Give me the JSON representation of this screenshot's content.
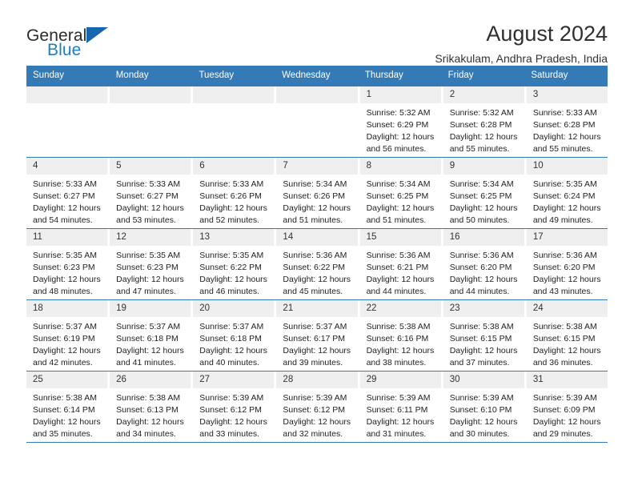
{
  "brand": {
    "name_part1": "General",
    "name_part2": "Blue",
    "triangle_color": "#1667ae",
    "blue_color": "#1b7fc4"
  },
  "header": {
    "title": "August 2024",
    "location": "Srikakulam, Andhra Pradesh, India"
  },
  "theme": {
    "header_bg": "#337ab7",
    "header_text": "#ffffff",
    "daynum_bg": "#efefef",
    "row_divider": "#337ab7"
  },
  "weekdays": [
    "Sunday",
    "Monday",
    "Tuesday",
    "Wednesday",
    "Thursday",
    "Friday",
    "Saturday"
  ],
  "labels": {
    "sunrise_prefix": "Sunrise: ",
    "sunset_prefix": "Sunset: ",
    "daylight_prefix": "Daylight: "
  },
  "weeks": [
    [
      {
        "day": "",
        "sunrise": "",
        "sunset": "",
        "daylight_line1": "",
        "daylight_line2": ""
      },
      {
        "day": "",
        "sunrise": "",
        "sunset": "",
        "daylight_line1": "",
        "daylight_line2": ""
      },
      {
        "day": "",
        "sunrise": "",
        "sunset": "",
        "daylight_line1": "",
        "daylight_line2": ""
      },
      {
        "day": "",
        "sunrise": "",
        "sunset": "",
        "daylight_line1": "",
        "daylight_line2": ""
      },
      {
        "day": "1",
        "sunrise": "Sunrise: 5:32 AM",
        "sunset": "Sunset: 6:29 PM",
        "daylight_line1": "Daylight: 12 hours",
        "daylight_line2": "and 56 minutes."
      },
      {
        "day": "2",
        "sunrise": "Sunrise: 5:32 AM",
        "sunset": "Sunset: 6:28 PM",
        "daylight_line1": "Daylight: 12 hours",
        "daylight_line2": "and 55 minutes."
      },
      {
        "day": "3",
        "sunrise": "Sunrise: 5:33 AM",
        "sunset": "Sunset: 6:28 PM",
        "daylight_line1": "Daylight: 12 hours",
        "daylight_line2": "and 55 minutes."
      }
    ],
    [
      {
        "day": "4",
        "sunrise": "Sunrise: 5:33 AM",
        "sunset": "Sunset: 6:27 PM",
        "daylight_line1": "Daylight: 12 hours",
        "daylight_line2": "and 54 minutes."
      },
      {
        "day": "5",
        "sunrise": "Sunrise: 5:33 AM",
        "sunset": "Sunset: 6:27 PM",
        "daylight_line1": "Daylight: 12 hours",
        "daylight_line2": "and 53 minutes."
      },
      {
        "day": "6",
        "sunrise": "Sunrise: 5:33 AM",
        "sunset": "Sunset: 6:26 PM",
        "daylight_line1": "Daylight: 12 hours",
        "daylight_line2": "and 52 minutes."
      },
      {
        "day": "7",
        "sunrise": "Sunrise: 5:34 AM",
        "sunset": "Sunset: 6:26 PM",
        "daylight_line1": "Daylight: 12 hours",
        "daylight_line2": "and 51 minutes."
      },
      {
        "day": "8",
        "sunrise": "Sunrise: 5:34 AM",
        "sunset": "Sunset: 6:25 PM",
        "daylight_line1": "Daylight: 12 hours",
        "daylight_line2": "and 51 minutes."
      },
      {
        "day": "9",
        "sunrise": "Sunrise: 5:34 AM",
        "sunset": "Sunset: 6:25 PM",
        "daylight_line1": "Daylight: 12 hours",
        "daylight_line2": "and 50 minutes."
      },
      {
        "day": "10",
        "sunrise": "Sunrise: 5:35 AM",
        "sunset": "Sunset: 6:24 PM",
        "daylight_line1": "Daylight: 12 hours",
        "daylight_line2": "and 49 minutes."
      }
    ],
    [
      {
        "day": "11",
        "sunrise": "Sunrise: 5:35 AM",
        "sunset": "Sunset: 6:23 PM",
        "daylight_line1": "Daylight: 12 hours",
        "daylight_line2": "and 48 minutes."
      },
      {
        "day": "12",
        "sunrise": "Sunrise: 5:35 AM",
        "sunset": "Sunset: 6:23 PM",
        "daylight_line1": "Daylight: 12 hours",
        "daylight_line2": "and 47 minutes."
      },
      {
        "day": "13",
        "sunrise": "Sunrise: 5:35 AM",
        "sunset": "Sunset: 6:22 PM",
        "daylight_line1": "Daylight: 12 hours",
        "daylight_line2": "and 46 minutes."
      },
      {
        "day": "14",
        "sunrise": "Sunrise: 5:36 AM",
        "sunset": "Sunset: 6:22 PM",
        "daylight_line1": "Daylight: 12 hours",
        "daylight_line2": "and 45 minutes."
      },
      {
        "day": "15",
        "sunrise": "Sunrise: 5:36 AM",
        "sunset": "Sunset: 6:21 PM",
        "daylight_line1": "Daylight: 12 hours",
        "daylight_line2": "and 44 minutes."
      },
      {
        "day": "16",
        "sunrise": "Sunrise: 5:36 AM",
        "sunset": "Sunset: 6:20 PM",
        "daylight_line1": "Daylight: 12 hours",
        "daylight_line2": "and 44 minutes."
      },
      {
        "day": "17",
        "sunrise": "Sunrise: 5:36 AM",
        "sunset": "Sunset: 6:20 PM",
        "daylight_line1": "Daylight: 12 hours",
        "daylight_line2": "and 43 minutes."
      }
    ],
    [
      {
        "day": "18",
        "sunrise": "Sunrise: 5:37 AM",
        "sunset": "Sunset: 6:19 PM",
        "daylight_line1": "Daylight: 12 hours",
        "daylight_line2": "and 42 minutes."
      },
      {
        "day": "19",
        "sunrise": "Sunrise: 5:37 AM",
        "sunset": "Sunset: 6:18 PM",
        "daylight_line1": "Daylight: 12 hours",
        "daylight_line2": "and 41 minutes."
      },
      {
        "day": "20",
        "sunrise": "Sunrise: 5:37 AM",
        "sunset": "Sunset: 6:18 PM",
        "daylight_line1": "Daylight: 12 hours",
        "daylight_line2": "and 40 minutes."
      },
      {
        "day": "21",
        "sunrise": "Sunrise: 5:37 AM",
        "sunset": "Sunset: 6:17 PM",
        "daylight_line1": "Daylight: 12 hours",
        "daylight_line2": "and 39 minutes."
      },
      {
        "day": "22",
        "sunrise": "Sunrise: 5:38 AM",
        "sunset": "Sunset: 6:16 PM",
        "daylight_line1": "Daylight: 12 hours",
        "daylight_line2": "and 38 minutes."
      },
      {
        "day": "23",
        "sunrise": "Sunrise: 5:38 AM",
        "sunset": "Sunset: 6:15 PM",
        "daylight_line1": "Daylight: 12 hours",
        "daylight_line2": "and 37 minutes."
      },
      {
        "day": "24",
        "sunrise": "Sunrise: 5:38 AM",
        "sunset": "Sunset: 6:15 PM",
        "daylight_line1": "Daylight: 12 hours",
        "daylight_line2": "and 36 minutes."
      }
    ],
    [
      {
        "day": "25",
        "sunrise": "Sunrise: 5:38 AM",
        "sunset": "Sunset: 6:14 PM",
        "daylight_line1": "Daylight: 12 hours",
        "daylight_line2": "and 35 minutes."
      },
      {
        "day": "26",
        "sunrise": "Sunrise: 5:38 AM",
        "sunset": "Sunset: 6:13 PM",
        "daylight_line1": "Daylight: 12 hours",
        "daylight_line2": "and 34 minutes."
      },
      {
        "day": "27",
        "sunrise": "Sunrise: 5:39 AM",
        "sunset": "Sunset: 6:12 PM",
        "daylight_line1": "Daylight: 12 hours",
        "daylight_line2": "and 33 minutes."
      },
      {
        "day": "28",
        "sunrise": "Sunrise: 5:39 AM",
        "sunset": "Sunset: 6:12 PM",
        "daylight_line1": "Daylight: 12 hours",
        "daylight_line2": "and 32 minutes."
      },
      {
        "day": "29",
        "sunrise": "Sunrise: 5:39 AM",
        "sunset": "Sunset: 6:11 PM",
        "daylight_line1": "Daylight: 12 hours",
        "daylight_line2": "and 31 minutes."
      },
      {
        "day": "30",
        "sunrise": "Sunrise: 5:39 AM",
        "sunset": "Sunset: 6:10 PM",
        "daylight_line1": "Daylight: 12 hours",
        "daylight_line2": "and 30 minutes."
      },
      {
        "day": "31",
        "sunrise": "Sunrise: 5:39 AM",
        "sunset": "Sunset: 6:09 PM",
        "daylight_line1": "Daylight: 12 hours",
        "daylight_line2": "and 29 minutes."
      }
    ]
  ]
}
